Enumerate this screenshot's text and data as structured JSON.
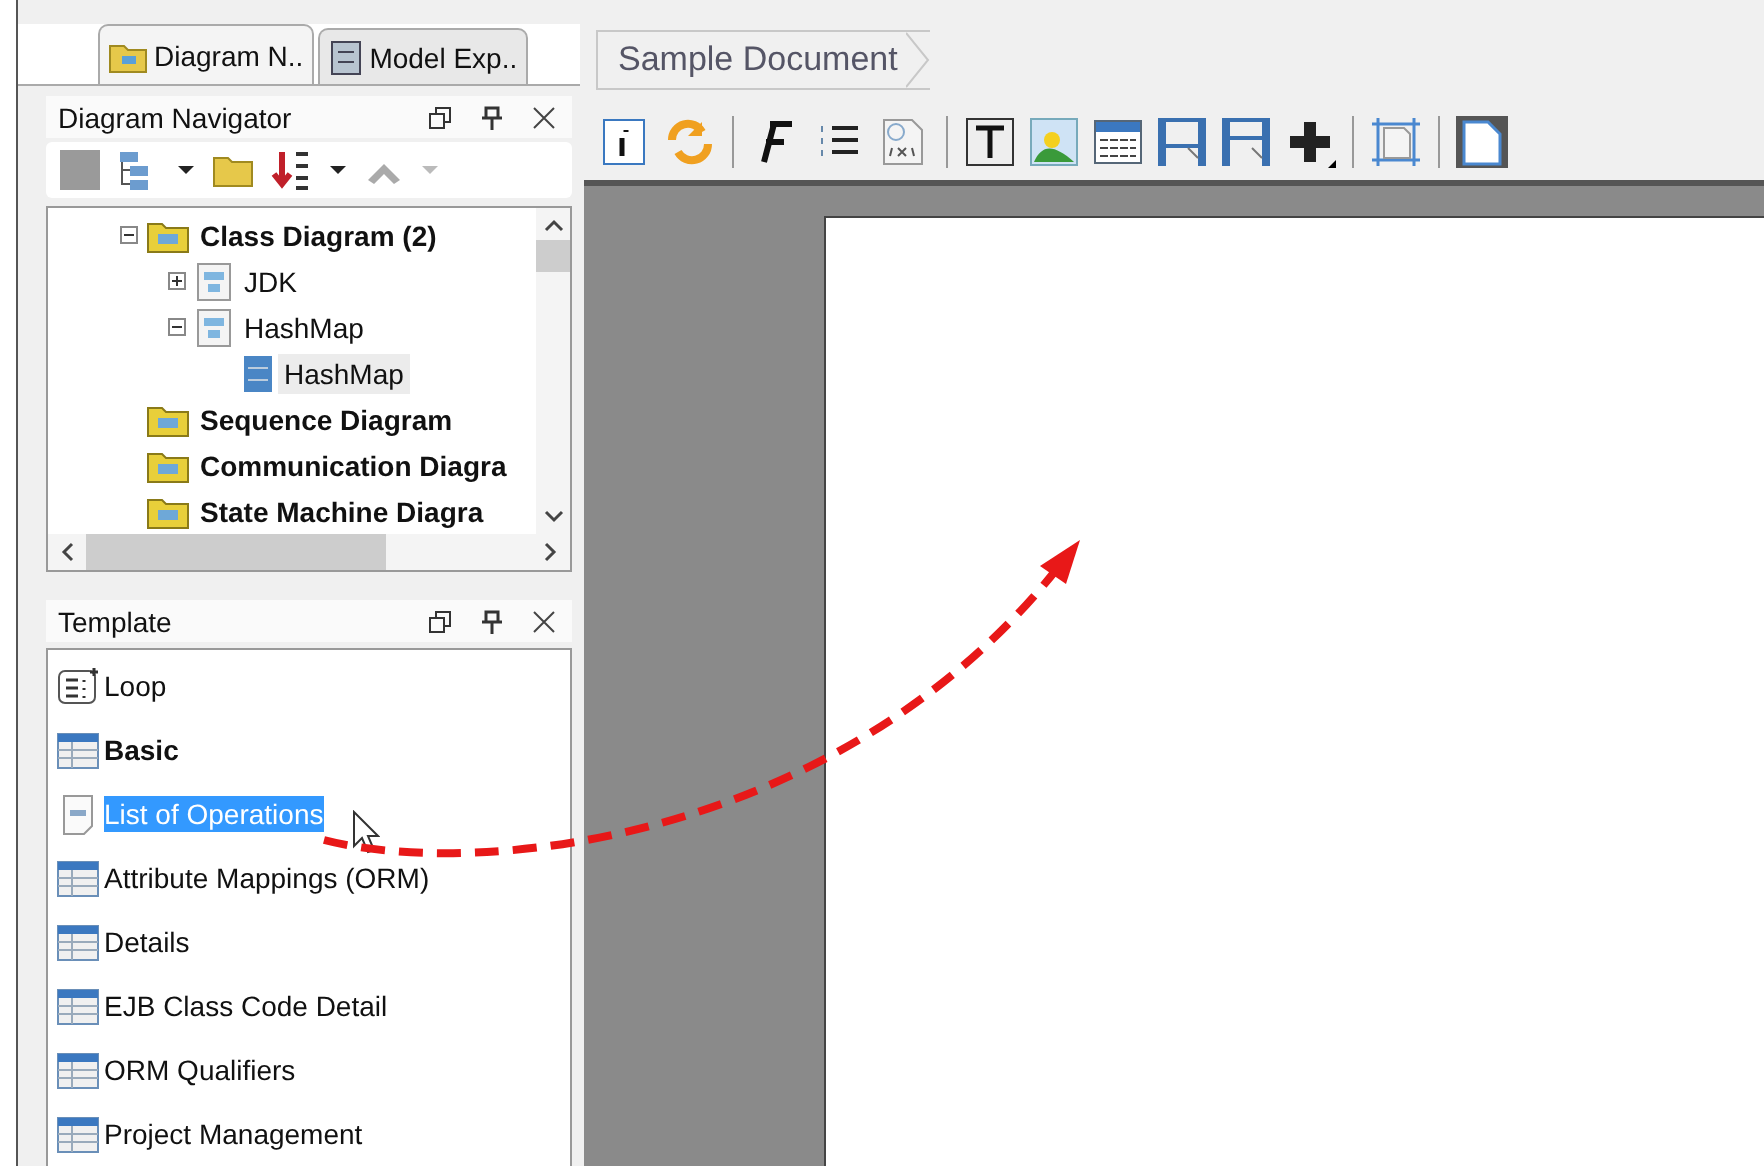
{
  "left_tabs": [
    {
      "label": "Diagram N..",
      "selected": true
    },
    {
      "label": "Model Exp..",
      "selected": false
    }
  ],
  "navigator": {
    "title": "Diagram Navigator",
    "tree": [
      {
        "label": "Class Diagram (2)",
        "kind": "category",
        "expanded": true,
        "selected": false,
        "children": [
          {
            "label": "JDK",
            "kind": "model",
            "expanded": false,
            "selected": false
          },
          {
            "label": "HashMap",
            "kind": "model",
            "expanded": true,
            "selected": false,
            "children": [
              {
                "label": "HashMap",
                "kind": "class",
                "selected": true
              }
            ]
          }
        ]
      },
      {
        "label": "Sequence Diagram",
        "kind": "category",
        "selected": false
      },
      {
        "label": "Communication Diagra",
        "kind": "category",
        "selected": false
      },
      {
        "label": "State Machine Diagra",
        "kind": "category",
        "selected": false
      }
    ]
  },
  "template": {
    "title": "Template",
    "items": [
      {
        "label": "Loop",
        "kind": "loop",
        "bold": false,
        "selected": false
      },
      {
        "label": "Basic",
        "kind": "table",
        "bold": true,
        "selected": false
      },
      {
        "label": "List of Operations",
        "kind": "doc",
        "bold": false,
        "selected": true
      },
      {
        "label": "Attribute Mappings (ORM)",
        "kind": "table",
        "bold": false,
        "selected": false
      },
      {
        "label": "Details",
        "kind": "table",
        "bold": false,
        "selected": false
      },
      {
        "label": "EJB Class Code Detail",
        "kind": "table",
        "bold": false,
        "selected": false
      },
      {
        "label": "ORM Qualifiers",
        "kind": "table",
        "bold": false,
        "selected": false
      },
      {
        "label": "Project Management",
        "kind": "table",
        "bold": false,
        "selected": false
      }
    ]
  },
  "breadcrumb": "Sample Document"
}
